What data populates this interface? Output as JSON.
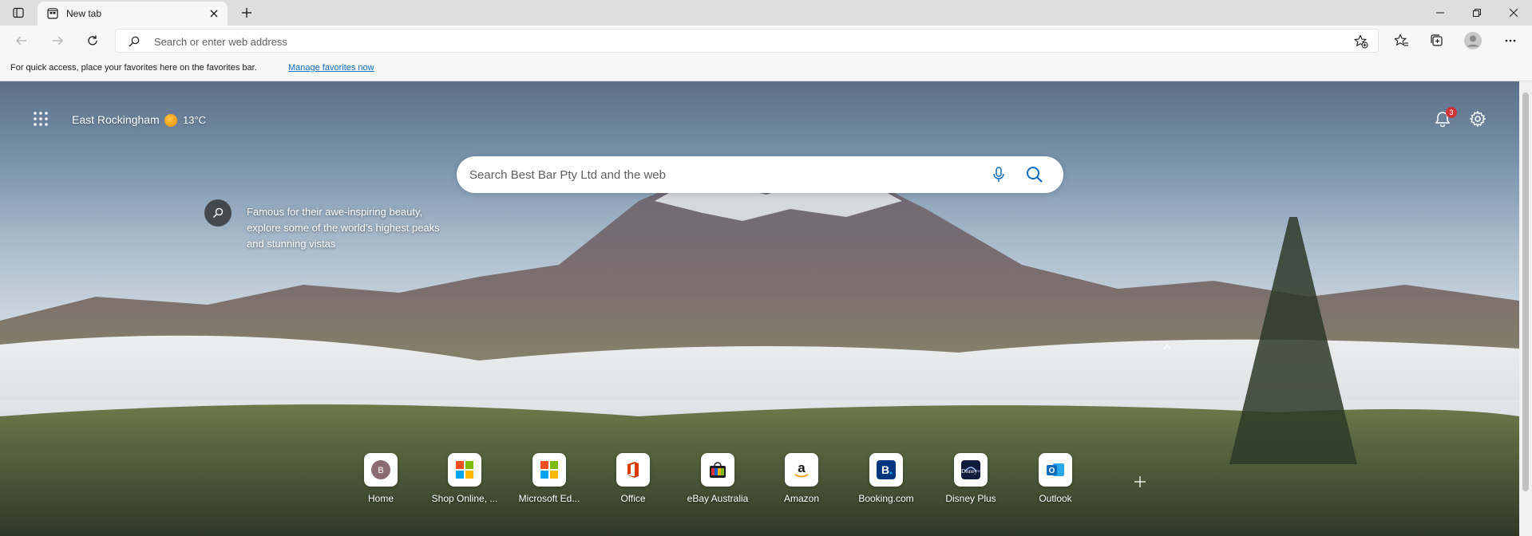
{
  "tab": {
    "title": "New tab"
  },
  "address_bar": {
    "placeholder": "Search or enter web address"
  },
  "favorites_bar": {
    "text": "For quick access, place your favorites here on the favorites bar.",
    "link": "Manage favorites now"
  },
  "ntp": {
    "location": "East Rockingham",
    "temperature": "13°C",
    "notification_count": "3",
    "search_placeholder": "Search Best Bar Pty Ltd and the web",
    "info_text": "Famous for their awe-inspiring beauty, explore some of the world's highest peaks and stunning vistas",
    "tiles": [
      {
        "label": "Home",
        "icon": "home-b-icon"
      },
      {
        "label": "Shop Online, ...",
        "icon": "microsoft-logo-icon"
      },
      {
        "label": "Microsoft Ed...",
        "icon": "microsoft-logo-icon"
      },
      {
        "label": "Office",
        "icon": "office-icon"
      },
      {
        "label": "eBay Australia",
        "icon": "ebay-icon"
      },
      {
        "label": "Amazon",
        "icon": "amazon-icon"
      },
      {
        "label": "Booking.com",
        "icon": "booking-icon"
      },
      {
        "label": "Disney Plus",
        "icon": "disney-icon"
      },
      {
        "label": "Outlook",
        "icon": "outlook-icon"
      }
    ]
  },
  "colors": {
    "accent": "#0f6cbd",
    "badge": "#d13438",
    "office": "#d83b01",
    "outlook": "#0f6cbd",
    "booking": "#003580",
    "disney": "#0e1b3c"
  }
}
